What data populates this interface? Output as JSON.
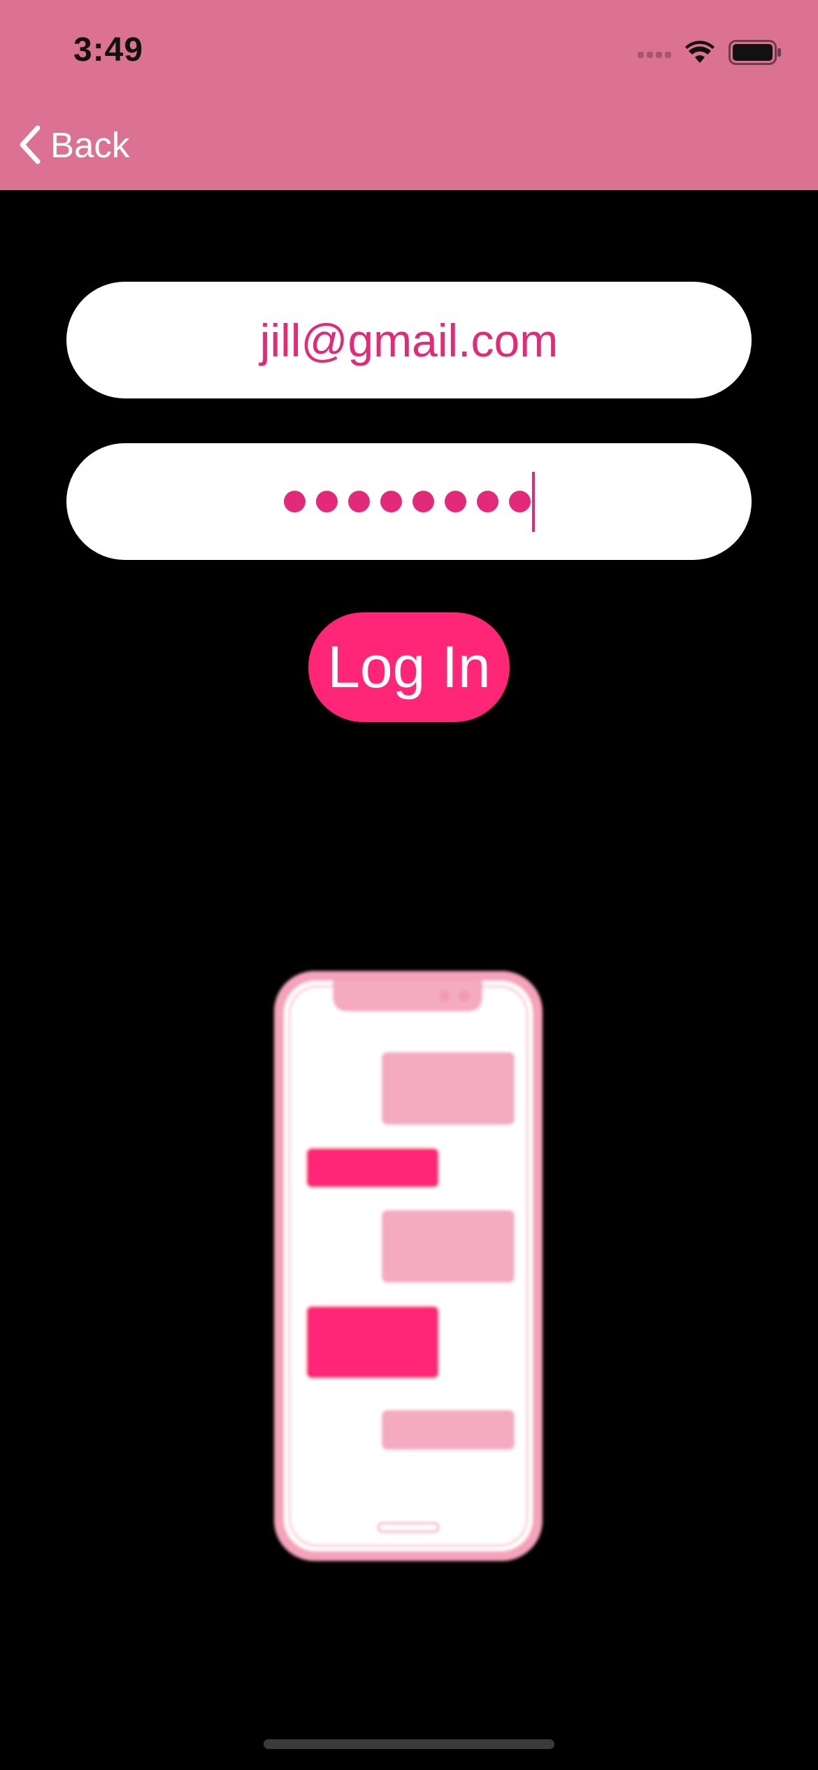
{
  "status_bar": {
    "time": "3:49"
  },
  "nav": {
    "back_label": "Back",
    "back_icon": "chevron-left-icon"
  },
  "form": {
    "email": {
      "value": "jill@gmail.com"
    },
    "password": {
      "masked_length": 8
    },
    "login_label": "Log In"
  },
  "illustration": {
    "icon": "phone-chat-illustration"
  },
  "colors": {
    "header": "#DC7293",
    "accent": "#FF2577",
    "text_accent": "#E22A78",
    "bubble_light": "#F4AAC0",
    "background": "#000000"
  }
}
